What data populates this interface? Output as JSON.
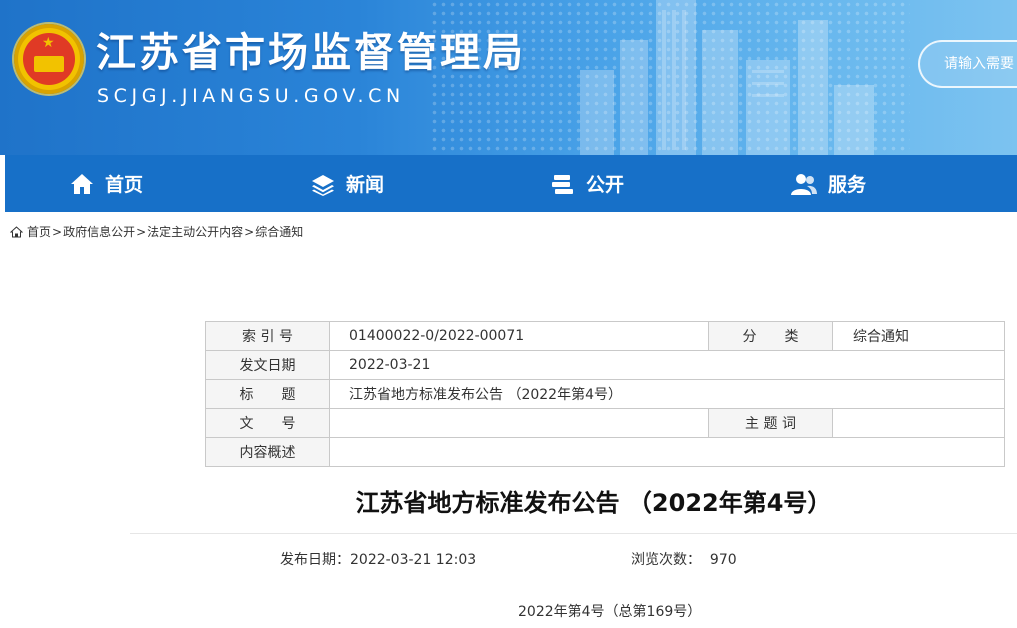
{
  "header": {
    "site_title": "江苏省市场监督管理局",
    "site_domain": "SCJGJ.JIANGSU.GOV.CN",
    "search_placeholder": "请输入需要"
  },
  "nav": [
    {
      "label": "首页",
      "icon": "home-icon"
    },
    {
      "label": "新闻",
      "icon": "layers-icon"
    },
    {
      "label": "公开",
      "icon": "books-icon"
    },
    {
      "label": "服务",
      "icon": "users-icon"
    }
  ],
  "breadcrumb": {
    "home": "首页",
    "items": [
      "政府信息公开",
      "法定主动公开内容",
      "综合通知"
    ],
    "separator": ">"
  },
  "info_table": {
    "index_label": "索 引 号",
    "index_value": "01400022-0/2022-00071",
    "category_label": "分　　类",
    "category_value": "综合通知",
    "date_label": "发文日期",
    "date_value": "2022-03-21",
    "title_label": "标　　题",
    "title_value": "江苏省地方标准发布公告 （2022年第4号）",
    "docno_label": "文　　号",
    "docno_value": "",
    "keyword_label": "主 题 词",
    "keyword_value": "",
    "summary_label": "内容概述",
    "summary_value": ""
  },
  "article": {
    "title": "江苏省地方标准发布公告 （2022年第4号）",
    "publish_label": "发布日期：",
    "publish_value": "2022-03-21 12:03",
    "views_label": "浏览次数：",
    "views_value": "970",
    "issue_line": "2022年第4号（总第169号）"
  },
  "colors": {
    "nav_bg": "#1770c8",
    "banner_start": "#1f73c9",
    "banner_end": "#7cc3f0"
  }
}
